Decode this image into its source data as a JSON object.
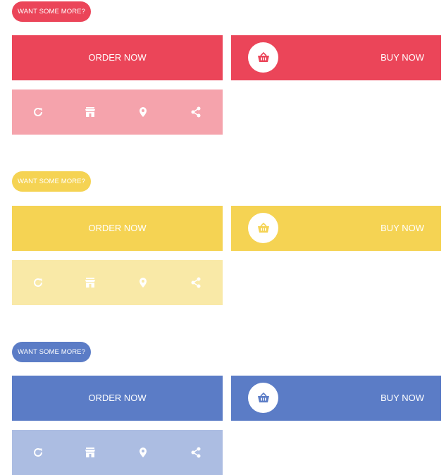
{
  "colors": {
    "red": "#eb4559",
    "red_light": "#f5a3ac",
    "yellow": "#f5d353",
    "yellow_light": "#f9e9a7",
    "blue": "#5b7cc6",
    "blue_light": "#acbde2"
  },
  "groups": [
    {
      "theme": "red",
      "pill_label": "WANT SOME MORE?",
      "order_label": "ORDER NOW",
      "buy_label": "BUY NOW",
      "icons": [
        "refresh-icon",
        "store-icon",
        "location-pin-icon",
        "share-icon"
      ]
    },
    {
      "theme": "yellow",
      "pill_label": "WANT SOME MORE?",
      "order_label": "ORDER NOW",
      "buy_label": "BUY NOW",
      "icons": [
        "refresh-icon",
        "store-icon",
        "location-pin-icon",
        "share-icon"
      ]
    },
    {
      "theme": "blue",
      "pill_label": "WANT SOME MORE?",
      "order_label": "ORDER NOW",
      "buy_label": "BUY NOW",
      "icons": [
        "refresh-icon",
        "store-icon",
        "location-pin-icon",
        "share-icon"
      ]
    }
  ]
}
